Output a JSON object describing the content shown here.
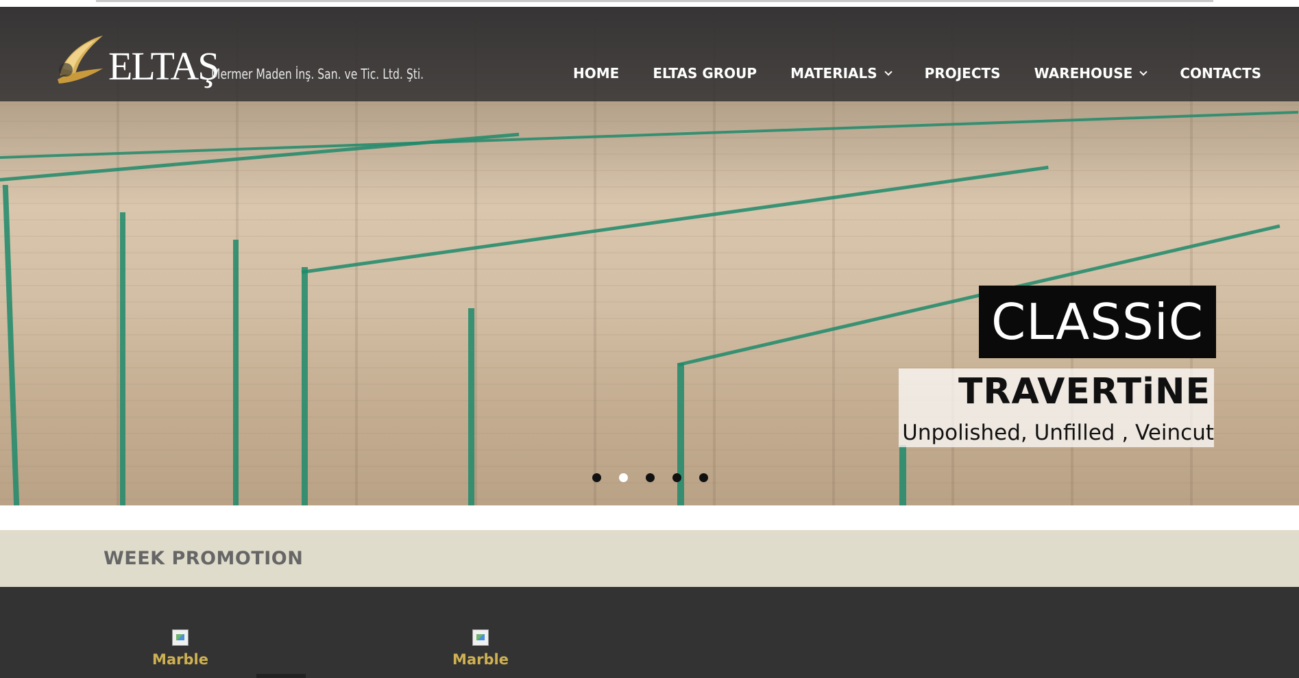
{
  "header": {
    "brand": "ELTAŞ",
    "brand_subtitle": "Mermer Maden İnş. San. ve Tic. Ltd. Şti.",
    "nav": [
      {
        "label": "HOME",
        "dropdown": false
      },
      {
        "label": "ELTAS GROUP",
        "dropdown": false
      },
      {
        "label": "MATERIALS",
        "dropdown": true
      },
      {
        "label": "PROJECTS",
        "dropdown": false
      },
      {
        "label": "WAREHOUSE",
        "dropdown": true
      },
      {
        "label": "CONTACTS",
        "dropdown": false
      }
    ]
  },
  "slider": {
    "caption_line1": "CLASSiC",
    "caption_line2": "TRAVERTiNE",
    "caption_line3": "Unpolished, Unfilled , Veincut",
    "dot_count": 5,
    "active_dot": 2
  },
  "promo": {
    "title": "WEEK PROMOTION",
    "cards": [
      {
        "label": "Marble",
        "icon": "broken-image-icon"
      },
      {
        "label": "Marble",
        "icon": "broken-image-icon"
      }
    ]
  },
  "colors": {
    "header_overlay": "#28282c",
    "promo_band": "#dfdccb",
    "dark_band": "#333333",
    "card_label": "#cfb153",
    "strap_green": "#1f8a6b"
  }
}
